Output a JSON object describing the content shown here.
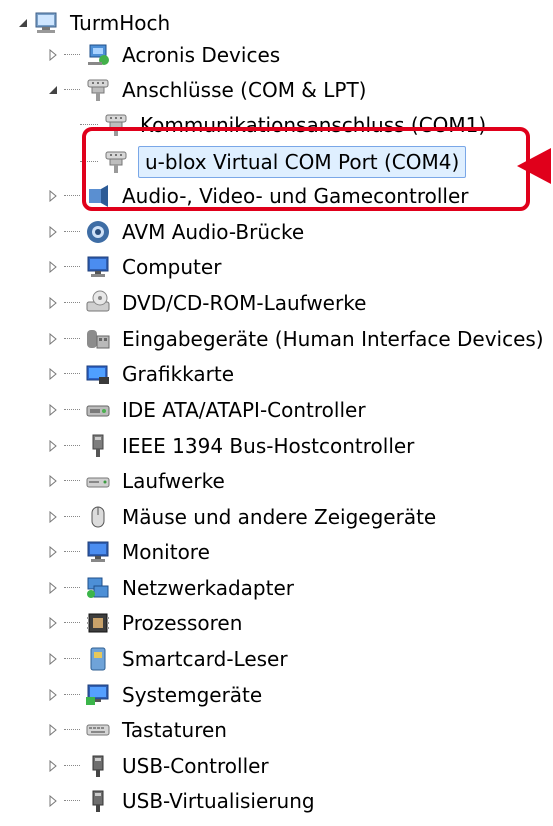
{
  "tree": {
    "root": {
      "label": "TurmHoch",
      "icon": "computer-icon",
      "expanded": true
    },
    "items": [
      {
        "label": "Acronis Devices",
        "icon": "network-device-icon",
        "level": 1,
        "expanded": false
      },
      {
        "label": "Anschlüsse (COM & LPT)",
        "icon": "port-icon",
        "level": 1,
        "expanded": true
      },
      {
        "label": "Kommunikationsanschluss (COM1)",
        "icon": "port-icon",
        "level": 2
      },
      {
        "label": "u-blox Virtual COM Port (COM4)",
        "icon": "port-icon",
        "level": 2,
        "selected": true
      },
      {
        "label": "Audio-, Video- und Gamecontroller",
        "icon": "audio-icon",
        "level": 1,
        "expanded": false
      },
      {
        "label": "AVM Audio-Brücke",
        "icon": "avm-icon",
        "level": 1,
        "expanded": false
      },
      {
        "label": "Computer",
        "icon": "monitor-icon",
        "level": 1,
        "expanded": false
      },
      {
        "label": "DVD/CD-ROM-Laufwerke",
        "icon": "dvd-drive-icon",
        "level": 1,
        "expanded": false
      },
      {
        "label": "Eingabegeräte (Human Interface Devices)",
        "icon": "hid-icon",
        "level": 1,
        "expanded": false
      },
      {
        "label": "Grafikkarte",
        "icon": "graphics-card-icon",
        "level": 1,
        "expanded": false
      },
      {
        "label": "IDE ATA/ATAPI-Controller",
        "icon": "ide-controller-icon",
        "level": 1,
        "expanded": false
      },
      {
        "label": "IEEE 1394 Bus-Hostcontroller",
        "icon": "firewire-icon",
        "level": 1,
        "expanded": false
      },
      {
        "label": "Laufwerke",
        "icon": "drive-icon",
        "level": 1,
        "expanded": false
      },
      {
        "label": "Mäuse und andere Zeigegeräte",
        "icon": "mouse-icon",
        "level": 1,
        "expanded": false
      },
      {
        "label": "Monitore",
        "icon": "monitor-icon",
        "level": 1,
        "expanded": false
      },
      {
        "label": "Netzwerkadapter",
        "icon": "network-adapter-icon",
        "level": 1,
        "expanded": false
      },
      {
        "label": "Prozessoren",
        "icon": "processor-icon",
        "level": 1,
        "expanded": false
      },
      {
        "label": "Smartcard-Leser",
        "icon": "smartcard-icon",
        "level": 1,
        "expanded": false
      },
      {
        "label": "Systemgeräte",
        "icon": "system-icon",
        "level": 1,
        "expanded": false
      },
      {
        "label": "Tastaturen",
        "icon": "keyboard-icon",
        "level": 1,
        "expanded": false
      },
      {
        "label": "USB-Controller",
        "icon": "usb-icon",
        "level": 1,
        "expanded": false
      },
      {
        "label": "USB-Virtualisierung",
        "icon": "usb-icon",
        "level": 1,
        "expanded": false
      }
    ]
  },
  "annotation": {
    "color": "#e0001b"
  }
}
